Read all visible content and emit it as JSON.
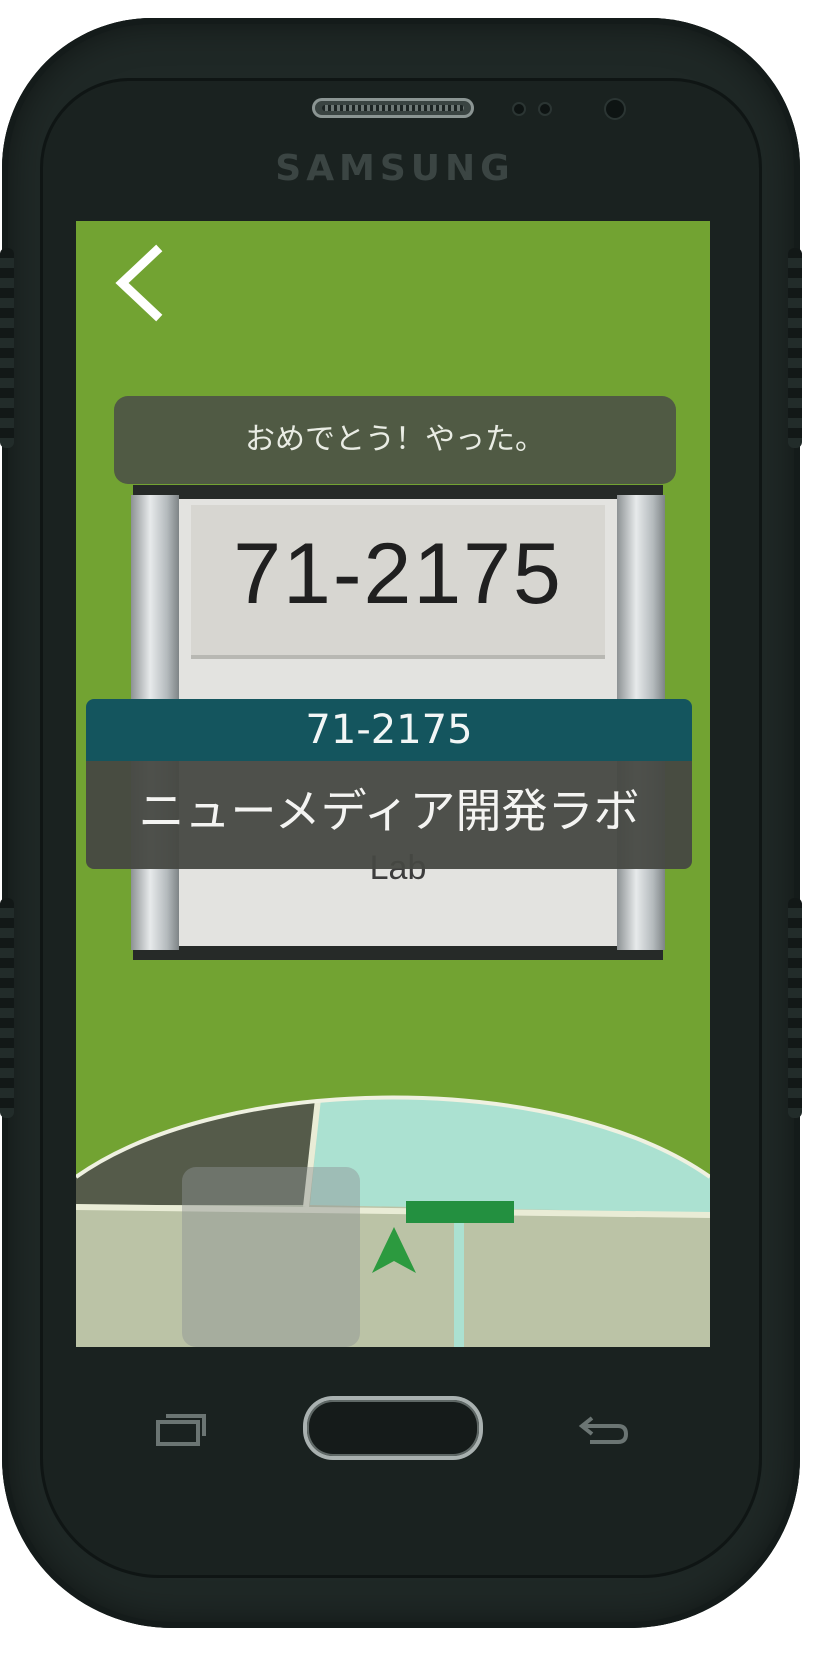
{
  "device": {
    "brand": "SAMSUNG"
  },
  "header": {
    "back_icon": "chevron-left-icon"
  },
  "banner": {
    "message": "おめでとう！やった。"
  },
  "camera_view": {
    "sign_number": "71-2175",
    "sign_subtitle": "Lab"
  },
  "room": {
    "number": "71-2175",
    "name": "ニューメディア開発ラボ"
  },
  "minimap": {
    "position_marker_icon": "location-arrow-icon",
    "destination_marker": "destination-bar",
    "colors": {
      "room_dark": "#4c5342",
      "room_target": "#abe1d1",
      "corridor": "#bbc3a6",
      "marker": "#2c9a3f",
      "destination": "#239040"
    }
  },
  "navigation_bar": {
    "recent_apps_icon": "recent-apps-icon",
    "home_icon": "home-button",
    "back_icon": "back-arrow-icon"
  },
  "colors": {
    "background_green": "#72a332",
    "room_number_bar": "#14555e",
    "card_dark": "#464842"
  }
}
